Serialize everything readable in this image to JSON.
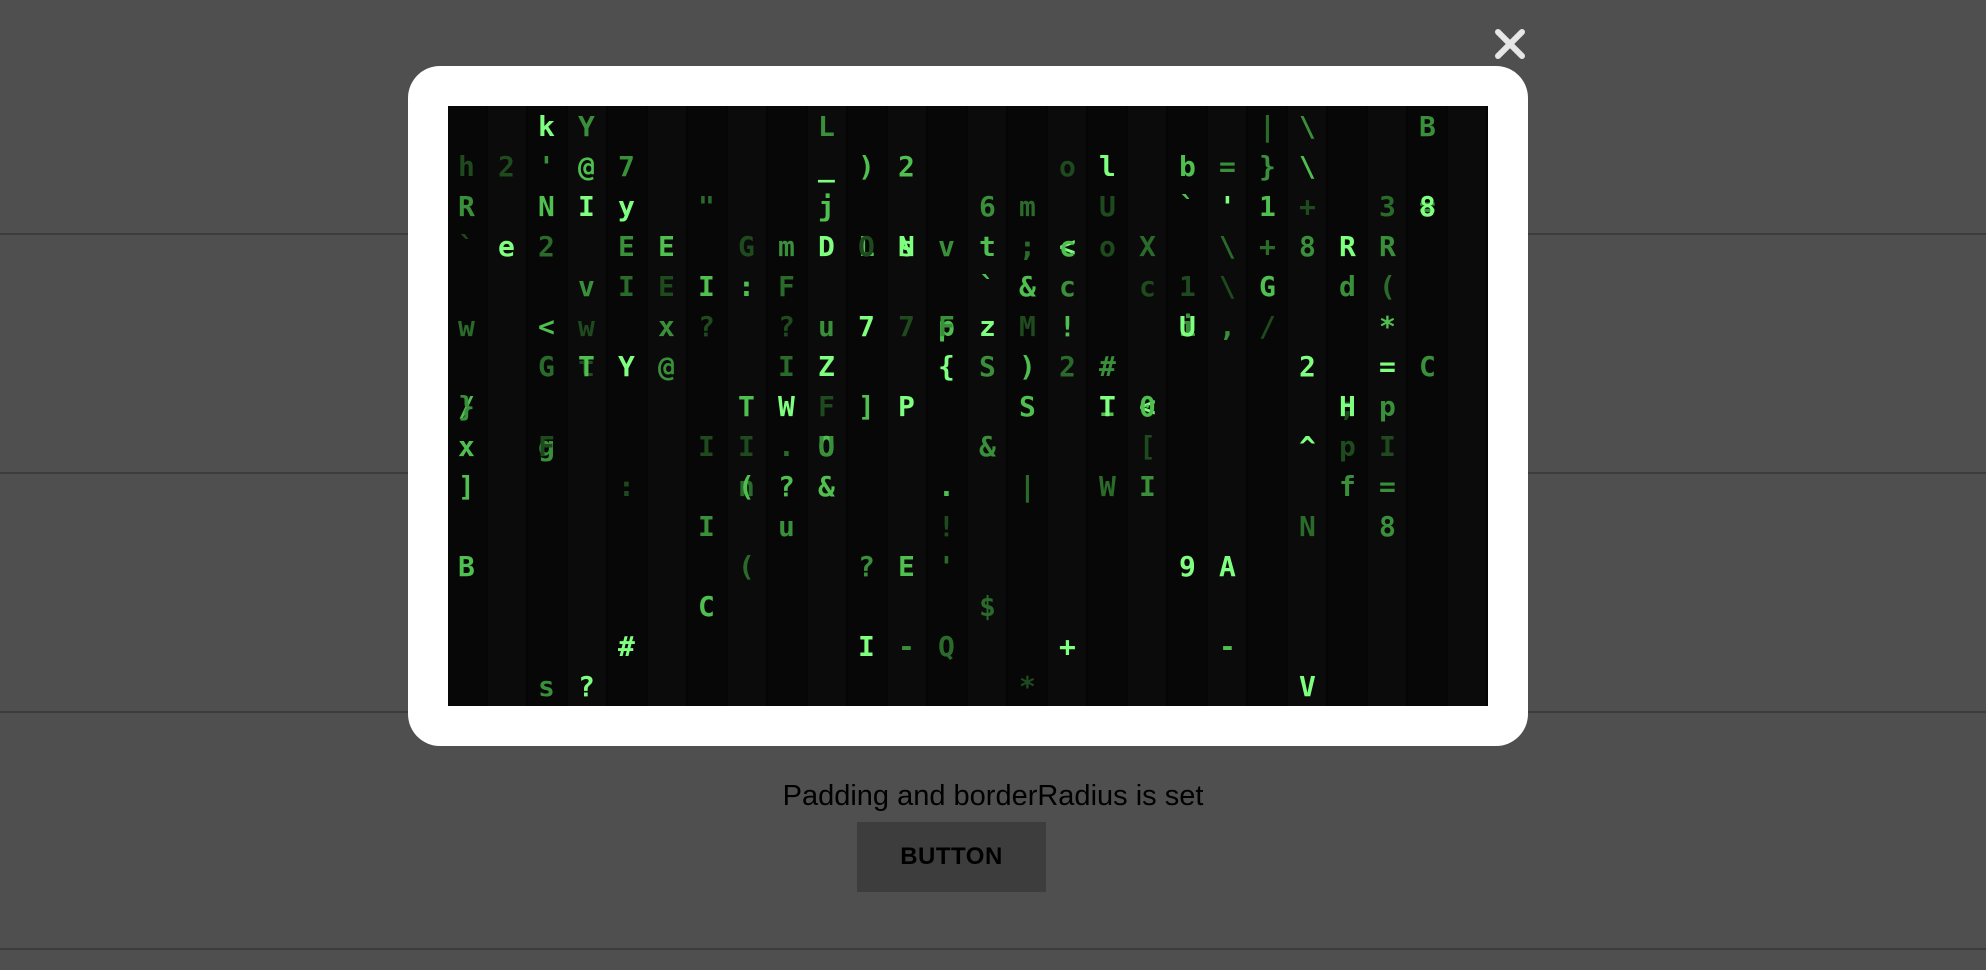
{
  "page": {
    "background_color": "#4f4f4f",
    "close_icon": "close-icon"
  },
  "modal": {
    "image_name": "matrix-code-rain",
    "glyph_columns": [
      "hR`/wB}x]",
      "2e",
      "k'N2g<GsF87",
      "Y@ItvwT?",
      "7yEI:Y#1U",
      "EEx@",
      "\".I?ICI@ii",
      "G:Tn(I(u}",
      "mF?IW.?u",
      "L_jDOuZFU&",
      ")LO]7?I",
      "2NsP7E-#2",
      "vpF{'Q.!}",
      "6t`zS$&1",
      "m;&M)S*|",
      "o<cc!2+%",
      "lUoIW#T?J",
      "Xc<I0[",
      "b`i1U9",
      "='\\\\,A-",
      "|}1+G/",
      "\\\\+8^N2V",
      "Rd;fHp&|",
      "3R(*=pI=8",
      "B=8C"
    ]
  },
  "caption": {
    "text": "Padding and borderRadius is set"
  },
  "button": {
    "label": "BUTTON"
  }
}
